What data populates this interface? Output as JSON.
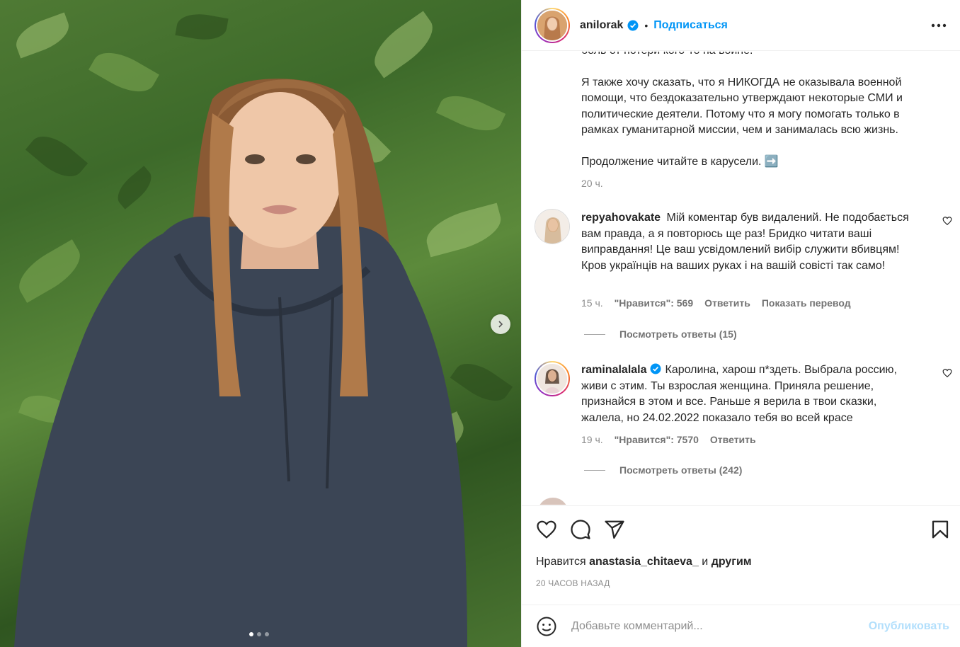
{
  "colors": {
    "accent": "#0095f6",
    "text": "#262626",
    "muted": "#8e8e8e",
    "publish_disabled": "#b2dffc"
  },
  "header": {
    "username": "anilorak",
    "follow_label": "Подписаться",
    "separator": "•"
  },
  "caption": {
    "cut_line": "боль от потери кого-то на войне.",
    "para1": "Я также хочу сказать, что я НИКОГДА не оказывала военной\nпомощи, что бездоказательно утверждают некоторые СМИ и\nполитические деятели. Потому что я могу помогать только в\nрамках гуманитарной миссии, чем и занималась всю жизнь.",
    "para2": "Продолжение читайте в карусели. ➡️",
    "time": "20 ч."
  },
  "comments": [
    {
      "username": "repyahovakate",
      "text": "Мій коментар був видалений. Не подобається вам правда, а я повторюсь ще раз! Бридко читати ваші виправдання! Це ваш усвідомлений вибір служити вбивцям! Кров українців на ваших руках і на вашій совісті так само!",
      "time": "15 ч.",
      "likes": "\"Нравится\": 569",
      "reply": "Ответить",
      "translate": "Показать перевод",
      "replies": "Посмотреть ответы (15)"
    },
    {
      "username": "raminalalala",
      "text": "Каролина, харош п*здеть. Выбрала россию, живи с этим. Ты взрослая женщина. Приняла решение, признайся в этом и все. Раньше я верила в твои сказки, жалела, но 24.02.2022 показало тебя во всей красе",
      "time": "19 ч.",
      "likes": "\"Нравится\": 7570",
      "reply": "Ответить",
      "replies": "Посмотреть ответы (242)"
    }
  ],
  "likes": {
    "prefix": "Нравится",
    "user": "anastasia_chitaeva_",
    "and": "и",
    "others": "другим"
  },
  "ago": "20 ЧАСОВ НАЗАД",
  "add_comment": {
    "placeholder": "Добавьте комментарий...",
    "publish": "Опубликовать"
  },
  "carousel": {
    "slides": 3,
    "active": 1
  },
  "icons": [
    "next-arrow-icon",
    "verified-icon",
    "more-icon",
    "heart-icon",
    "comment-icon",
    "share-icon",
    "bookmark-icon",
    "emoji-icon"
  ]
}
